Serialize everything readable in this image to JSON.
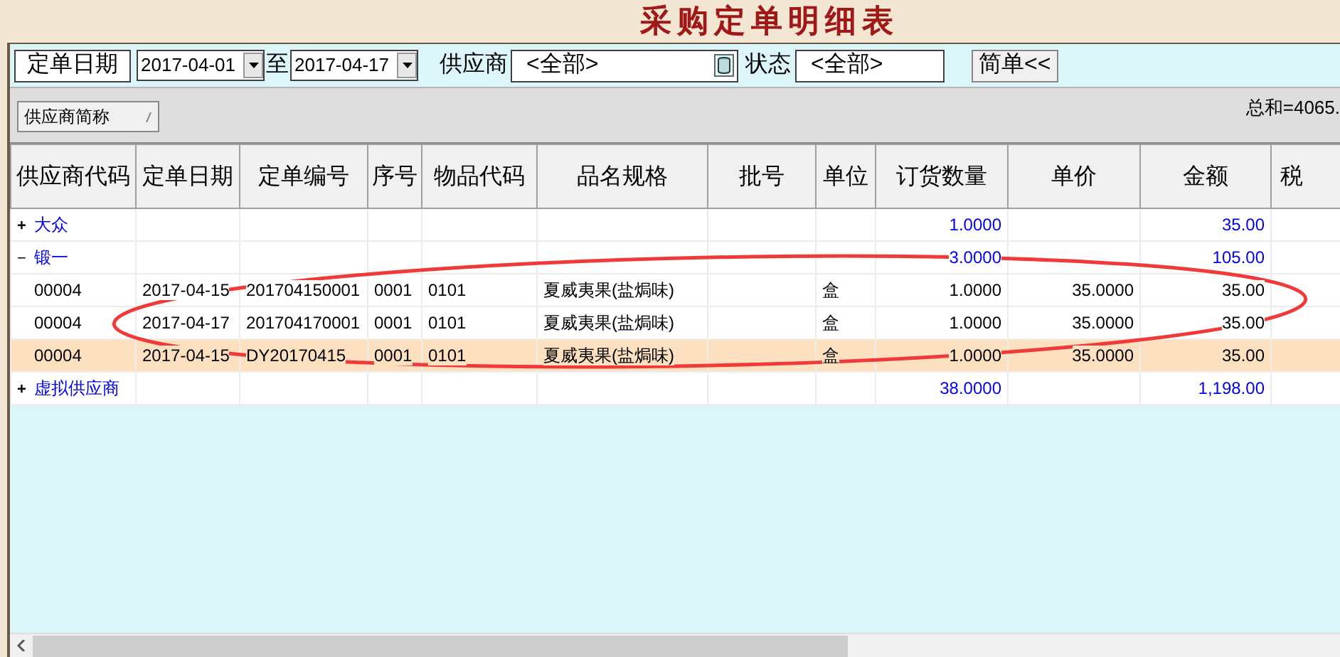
{
  "window": {
    "title": "采购定单明细表"
  },
  "filter_bar": {
    "date_label": "定单日期",
    "date_from": "2017-04-01",
    "range_separator": "至",
    "date_to": "2017-04-17",
    "supplier_label": "供应商",
    "supplier_value": "<全部>",
    "status_label": "状态",
    "status_value": "<全部>",
    "mode_button": "简单<<"
  },
  "group_bar": {
    "group_button": "供应商简称",
    "total": "总和=4065."
  },
  "table": {
    "columns": [
      "供应商代码",
      "定单日期",
      "定单编号",
      "序号",
      "物品代码",
      "品名规格",
      "批号",
      "单位",
      "订货数量",
      "单价",
      "金额",
      "税"
    ],
    "rows": [
      {
        "kind": "group",
        "expanded": false,
        "toggle": "+",
        "name": "大众",
        "qty": "1.0000",
        "amount": "35.00"
      },
      {
        "kind": "group",
        "expanded": true,
        "toggle": "−",
        "name": "锻一",
        "qty": "3.0000",
        "amount": "105.00"
      },
      {
        "kind": "detail",
        "selected": false,
        "cells": [
          "00004",
          "2017-04-15",
          "201704150001",
          "0001",
          "0101",
          "夏威夷果(盐焗味)",
          "",
          "盒",
          "1.0000",
          "35.0000",
          "35.00"
        ]
      },
      {
        "kind": "detail",
        "selected": false,
        "cells": [
          "00004",
          "2017-04-17",
          "201704170001",
          "0001",
          "0101",
          "夏威夷果(盐焗味)",
          "",
          "盒",
          "1.0000",
          "35.0000",
          "35.00"
        ]
      },
      {
        "kind": "detail",
        "selected": true,
        "cells": [
          "00004",
          "2017-04-15",
          "DY20170415",
          "0001",
          "0101",
          "夏威夷果(盐焗味)",
          "",
          "盒",
          "1.0000",
          "35.0000",
          "35.00"
        ]
      },
      {
        "kind": "group",
        "expanded": false,
        "toggle": "+",
        "name": "虚拟供应商",
        "qty": "38.0000",
        "amount": "1,198.00"
      }
    ]
  }
}
